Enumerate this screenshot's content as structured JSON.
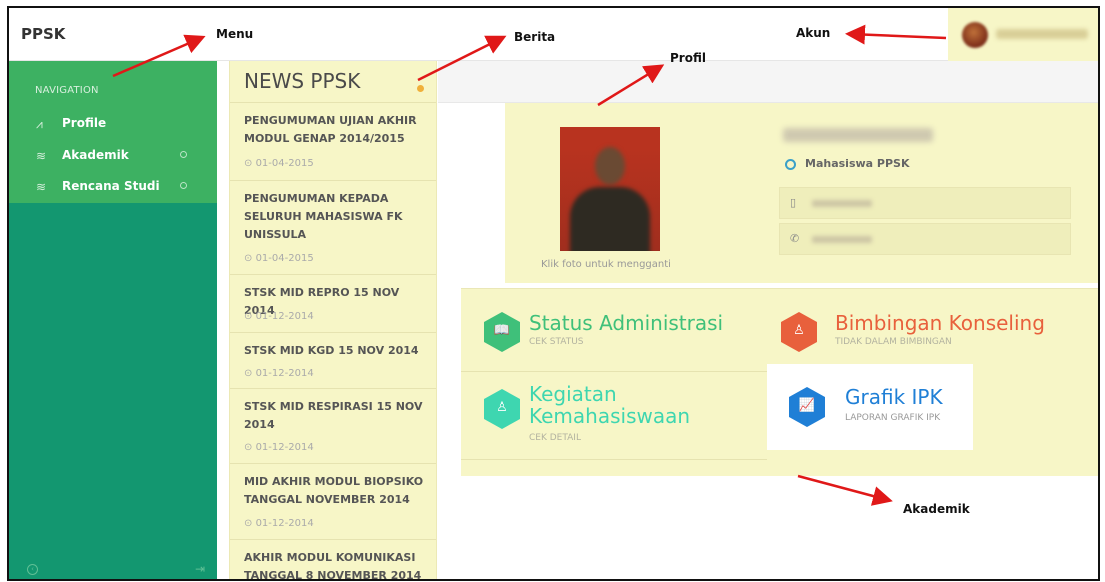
{
  "header": {
    "brand": "PPSK"
  },
  "sidebar": {
    "nav_title": "NAVIGATION",
    "items": [
      {
        "label": "Profile",
        "icon": "chart-line-icon"
      },
      {
        "label": "Akademik",
        "icon": "layers-icon"
      },
      {
        "label": "Rencana Studi",
        "icon": "layers-icon"
      }
    ]
  },
  "news": {
    "title": "NEWS PPSK",
    "items": [
      {
        "title": "PENGUMUMAN UJIAN AKHIR MODUL GENAP 2014/2015",
        "date": "01-04-2015"
      },
      {
        "title": "PENGUMUMAN KEPADA SELURUH MAHASISWA FK UNISSULA",
        "date": "01-04-2015"
      },
      {
        "title": "STSK MID REPRO 15 NOV 2014",
        "date": "01-12-2014"
      },
      {
        "title": "STSK MID KGD 15 NOV 2014",
        "date": "01-12-2014"
      },
      {
        "title": "STSK MID RESPIRASI 15 NOV 2014",
        "date": "01-12-2014"
      },
      {
        "title": "MID AKHIR MODUL BIOPSIKO TANGGAL NOVEMBER 2014",
        "date": "01-12-2014"
      },
      {
        "title": "AKHIR MODUL KOMUNIKASI TANGGAL 8 NOVEMBER 2014",
        "date": ""
      }
    ]
  },
  "profile": {
    "photo_caption": "Klik foto untuk mengganti",
    "role": "Mahasiswa PPSK"
  },
  "akademik": {
    "cards": [
      {
        "title": "Status Administrasi",
        "subtitle": "CEK STATUS",
        "color": "#3fc07a",
        "icon": "book-icon"
      },
      {
        "title": "Bimbingan Konseling",
        "subtitle": "TIDAK DALAM BIMBINGAN",
        "color": "#e8603c",
        "icon": "users-icon"
      },
      {
        "title": "Kegiatan Kemahasiswaan",
        "subtitle": "CEK DETAIL",
        "color": "#3ed6b0",
        "icon": "user-icon"
      },
      {
        "title": "Grafik IPK",
        "subtitle": "LAPORAN GRAFIK IPK",
        "color": "#1f7fd6",
        "icon": "chart-icon"
      }
    ]
  },
  "annotations": {
    "menu": "Menu",
    "berita": "Berita",
    "profil": "Profil",
    "akun": "Akun",
    "akademik": "Akademik"
  }
}
